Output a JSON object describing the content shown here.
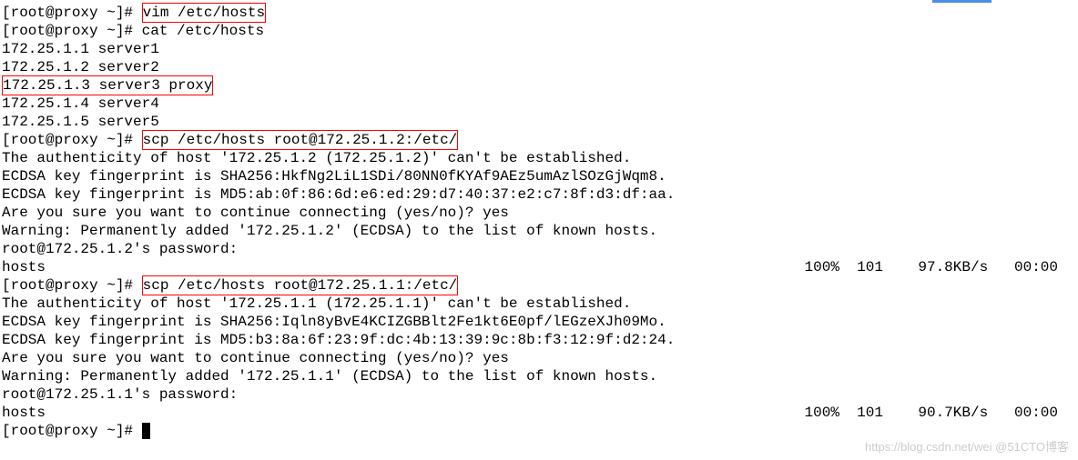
{
  "prompt": "[root@proxy ~]# ",
  "cmd1": "vim /etc/hosts",
  "cmd2": "cat /etc/hosts",
  "hosts": [
    "172.25.1.1 server1",
    "172.25.1.2 server2",
    "172.25.1.3 server3 proxy",
    "172.25.1.4 server4",
    "172.25.1.5 server5"
  ],
  "cmd3": "scp /etc/hosts root@172.25.1.2:/etc/",
  "scp1": {
    "auth_line": "The authenticity of host '172.25.1.2 (172.25.1.2)' can't be established.",
    "fp1": "ECDSA key fingerprint is SHA256:HkfNg2LiL1SDi/80NN0fKYAf9AEz5umAzlSOzGjWqm8.",
    "fp2": "ECDSA key fingerprint is MD5:ab:0f:86:6d:e6:ed:29:d7:40:37:e2:c7:8f:d3:df:aa.",
    "confirm": "Are you sure you want to continue connecting (yes/no)? yes",
    "warn": "Warning: Permanently added '172.25.1.2' (ECDSA) to the list of known hosts.",
    "pw": "root@172.25.1.2's password:",
    "file": "hosts",
    "stats": "100%  101    97.8KB/s   00:00"
  },
  "cmd4": "scp /etc/hosts root@172.25.1.1:/etc/",
  "scp2": {
    "auth_line": "The authenticity of host '172.25.1.1 (172.25.1.1)' can't be established.",
    "fp1": "ECDSA key fingerprint is SHA256:Iqln8yBvE4KCIZGBBlt2Fe1kt6E0pf/lEGzeXJh09Mo.",
    "fp2": "ECDSA key fingerprint is MD5:b3:8a:6f:23:9f:dc:4b:13:39:9c:8b:f3:12:9f:d2:24.",
    "confirm": "Are you sure you want to continue connecting (yes/no)? yes",
    "warn": "Warning: Permanently added '172.25.1.1' (ECDSA) to the list of known hosts.",
    "pw": "root@172.25.1.1's password:",
    "file": "hosts",
    "stats": "100%  101    90.7KB/s   00:00"
  },
  "watermark": "https://blog.csdn.net/wei @51CTO博客"
}
